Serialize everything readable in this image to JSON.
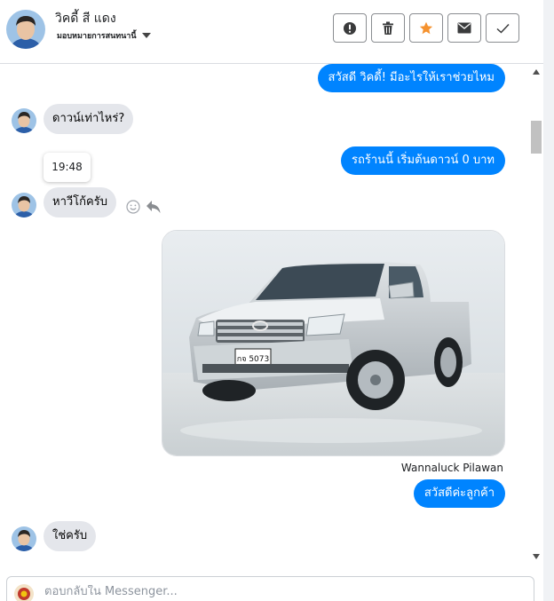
{
  "header": {
    "contact_name": "วิคดี้ สี แดง",
    "assign_label": "มอบหมายการสนทนานี้",
    "actions": [
      {
        "name": "mark-spam-button",
        "icon": "exclamation-icon"
      },
      {
        "name": "delete-button",
        "icon": "trash-icon"
      },
      {
        "name": "star-button",
        "icon": "star-icon"
      },
      {
        "name": "mark-unread-button",
        "icon": "envelope-icon"
      },
      {
        "name": "mark-done-button",
        "icon": "checkmark-icon"
      }
    ]
  },
  "messages": {
    "m1_out": "สวัสดี วิคดี้! มีอะไรให้เราช่วยไหม",
    "m2_in": "ดาวน์เท่าไหร่?",
    "m3_out": "รถร้านนี้ เริ่มต้นดาวน์ 0 บาท",
    "tooltip_time": "19:48",
    "m4_in": "หาวีโก้ครับ",
    "photo_plate": "กจ 5073",
    "sender_name": "Wannaluck Pilawan",
    "m5_out": "สวัสดีค่ะลูกค้า",
    "m6_in": "ใช่ครับ"
  },
  "composer": {
    "placeholder": "ตอบกลับใน Messenger..."
  },
  "colors": {
    "outgoing_bubble": "#0084ff",
    "incoming_bubble": "#e4e6eb",
    "star_accent": "#f5922f"
  }
}
